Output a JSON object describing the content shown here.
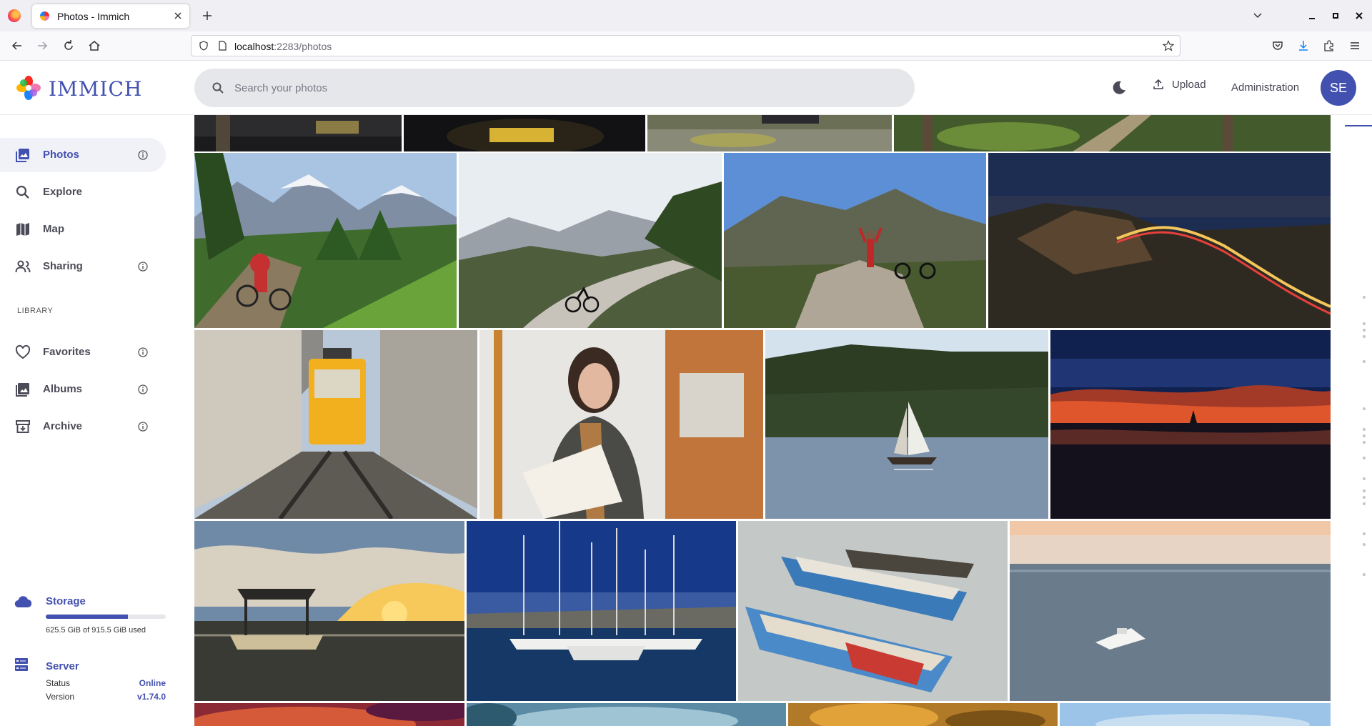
{
  "browser": {
    "tab_title": "Photos - Immich",
    "url_host": "localhost",
    "url_rest": ":2283/photos"
  },
  "app": {
    "logo_text": "IMMICH",
    "search_placeholder": "Search your photos",
    "upload_label": "Upload",
    "admin_label": "Administration",
    "avatar_initials": "SE",
    "brand_color": "#4250af"
  },
  "sidebar": {
    "items": [
      {
        "label": "Photos",
        "icon": "photos-icon"
      },
      {
        "label": "Explore",
        "icon": "search-icon"
      },
      {
        "label": "Map",
        "icon": "map-icon"
      },
      {
        "label": "Sharing",
        "icon": "sharing-icon"
      }
    ],
    "library_label": "LIBRARY",
    "library_items": [
      {
        "label": "Favorites",
        "icon": "heart-icon"
      },
      {
        "label": "Albums",
        "icon": "album-icon"
      },
      {
        "label": "Archive",
        "icon": "archive-icon"
      }
    ],
    "storage": {
      "title": "Storage",
      "usage_text": "625.5 GiB of 915.5 GiB used",
      "used_fraction": 0.683
    },
    "server": {
      "title": "Server",
      "status_label": "Status",
      "status_value": "Online",
      "version_label": "Version",
      "version_value": "v1.74.0"
    }
  }
}
